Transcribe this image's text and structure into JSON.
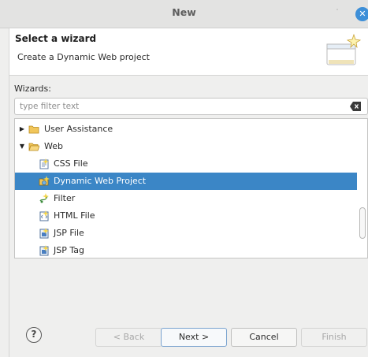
{
  "window": {
    "title": "New",
    "minimize_glyph": "˙",
    "close_glyph": "✕"
  },
  "header": {
    "title": "Select a wizard",
    "description": "Create a Dynamic Web project",
    "banner_icon": "new-wizard-banner-icon"
  },
  "wizards": {
    "label": "Wizards:",
    "filter_placeholder": "type filter text",
    "filter_value": "",
    "clear_icon": "clear-filter-icon"
  },
  "tree": {
    "items": [
      {
        "label": "User Assistance",
        "expanded": false,
        "icon": "folder-icon"
      },
      {
        "label": "Web",
        "expanded": true,
        "icon": "folder-open-icon"
      },
      {
        "label": "CSS File",
        "icon": "css-file-icon"
      },
      {
        "label": "Dynamic Web Project",
        "icon": "dynamic-web-project-icon",
        "selected": true
      },
      {
        "label": "Filter",
        "icon": "filter-icon"
      },
      {
        "label": "HTML File",
        "icon": "html-file-icon"
      },
      {
        "label": "JSP File",
        "icon": "jsp-file-icon"
      },
      {
        "label": "JSP Tag",
        "icon": "jsp-tag-icon"
      }
    ]
  },
  "buttons": {
    "help": "?",
    "back": "< Back",
    "next": "Next >",
    "cancel": "Cancel",
    "finish": "Finish"
  },
  "colors": {
    "selection": "#3b86c6",
    "close_button": "#3d8fd8",
    "folder": "#e8b84a"
  }
}
